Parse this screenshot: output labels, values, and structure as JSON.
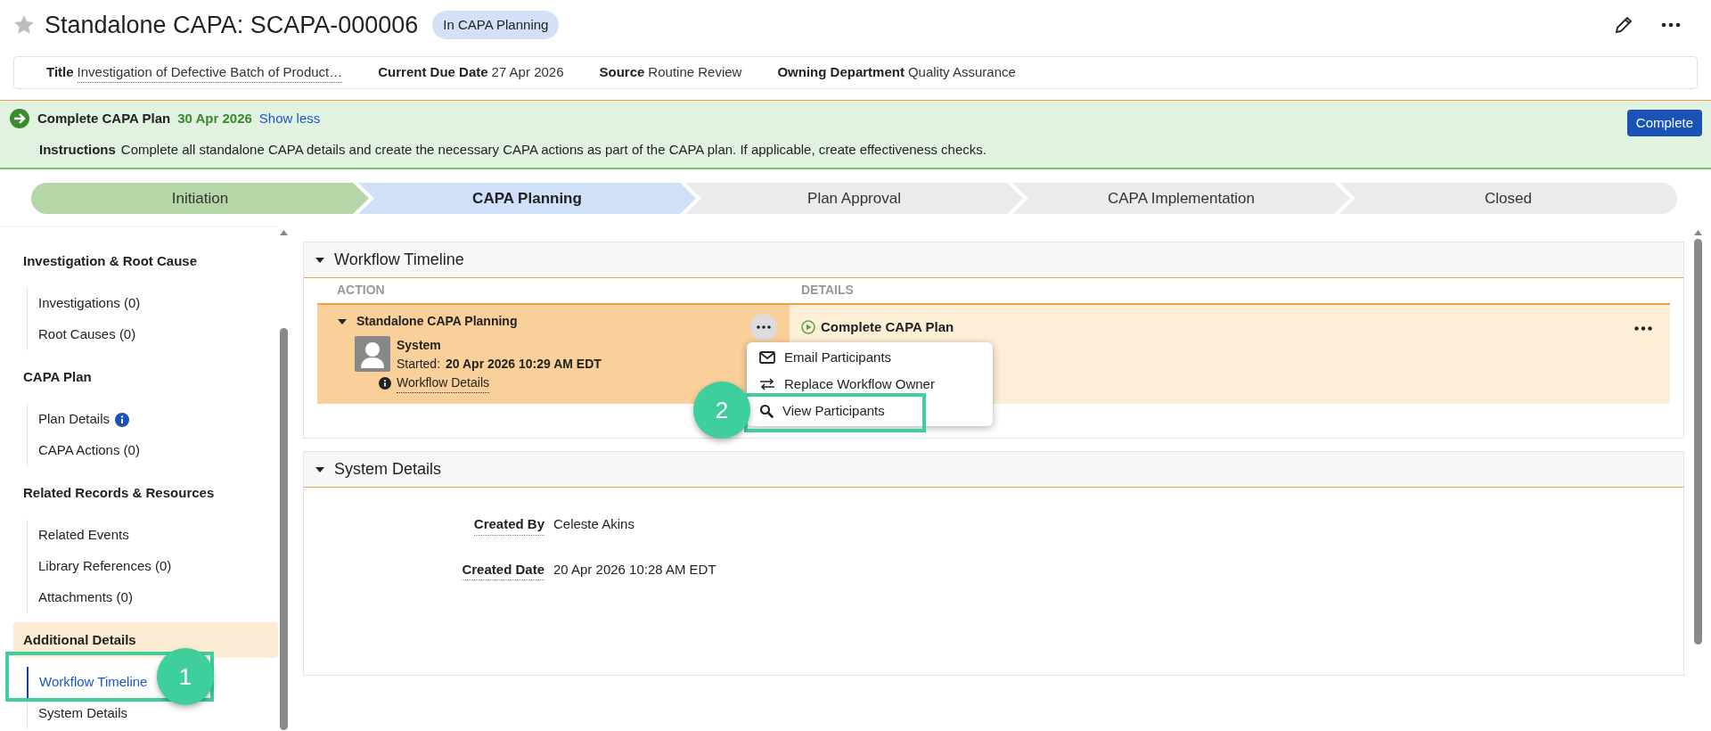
{
  "header": {
    "starred": false,
    "title": "Standalone CAPA: SCAPA-000006",
    "status": "In CAPA Planning"
  },
  "info_bar": [
    {
      "label": "Title",
      "value": "Investigation of Defective Batch of Product…",
      "link": true
    },
    {
      "label": "Current Due Date",
      "value": "27 Apr 2026",
      "link": false
    },
    {
      "label": "Source",
      "value": "Routine Review",
      "link": false
    },
    {
      "label": "Owning Department",
      "value": "Quality Assurance",
      "link": false
    }
  ],
  "task_banner": {
    "task": "Complete CAPA Plan",
    "due": "30 Apr 2026",
    "toggle": "Show less",
    "instructions_label": "Instructions",
    "instructions": "Complete all standalone CAPA details and create the necessary CAPA actions as part of the CAPA plan. If applicable, create effectiveness checks.",
    "button": "Complete"
  },
  "stages": [
    {
      "label": "Initiation",
      "kind": "complete"
    },
    {
      "label": "CAPA Planning",
      "kind": "current"
    },
    {
      "label": "Plan Approval",
      "kind": "upcoming"
    },
    {
      "label": "CAPA Implementation",
      "kind": "upcoming"
    },
    {
      "label": "Closed",
      "kind": "upcoming"
    }
  ],
  "sidebar": [
    {
      "heading": "Investigation & Root Cause",
      "selected": false,
      "items": [
        {
          "label": "Investigations (0)",
          "selected": false,
          "info": false
        },
        {
          "label": "Root Causes (0)",
          "selected": false,
          "info": false
        }
      ]
    },
    {
      "heading": "CAPA Plan",
      "selected": false,
      "items": [
        {
          "label": "Plan Details",
          "selected": false,
          "info": true
        },
        {
          "label": "CAPA Actions (0)",
          "selected": false,
          "info": false
        }
      ]
    },
    {
      "heading": "Related Records & Resources",
      "selected": false,
      "items": [
        {
          "label": "Related Events",
          "selected": false,
          "info": false
        },
        {
          "label": "Library References (0)",
          "selected": false,
          "info": false
        },
        {
          "label": "Attachments (0)",
          "selected": false,
          "info": false
        }
      ]
    },
    {
      "heading": "Additional Details",
      "selected": true,
      "items": [
        {
          "label": "Workflow Timeline",
          "selected": true,
          "info": false
        },
        {
          "label": "System Details",
          "selected": false,
          "info": false
        }
      ]
    }
  ],
  "workflow_timeline": {
    "title": "Workflow Timeline",
    "expanded": true,
    "columns": [
      "ACTION",
      "DETAILS"
    ],
    "row": {
      "workflow": "Standalone CAPA Planning",
      "expanded": true,
      "user": "System",
      "started_label": "Started:",
      "started": "20 Apr 2026 10:29 AM EDT",
      "details_link": "Workflow Details",
      "task": "Complete CAPA Plan"
    },
    "menu": [
      {
        "label": "Email Participants"
      },
      {
        "label": "Replace Workflow Owner"
      },
      {
        "label": "View Participants"
      }
    ]
  },
  "system_details": {
    "title": "System Details",
    "expanded": true,
    "fields": [
      {
        "label": "Created By",
        "value": "Celeste Akins"
      },
      {
        "label": "Created Date",
        "value": "20 Apr 2026 10:28 AM EDT"
      }
    ]
  },
  "callouts": [
    {
      "number": "1"
    },
    {
      "number": "2"
    }
  ]
}
